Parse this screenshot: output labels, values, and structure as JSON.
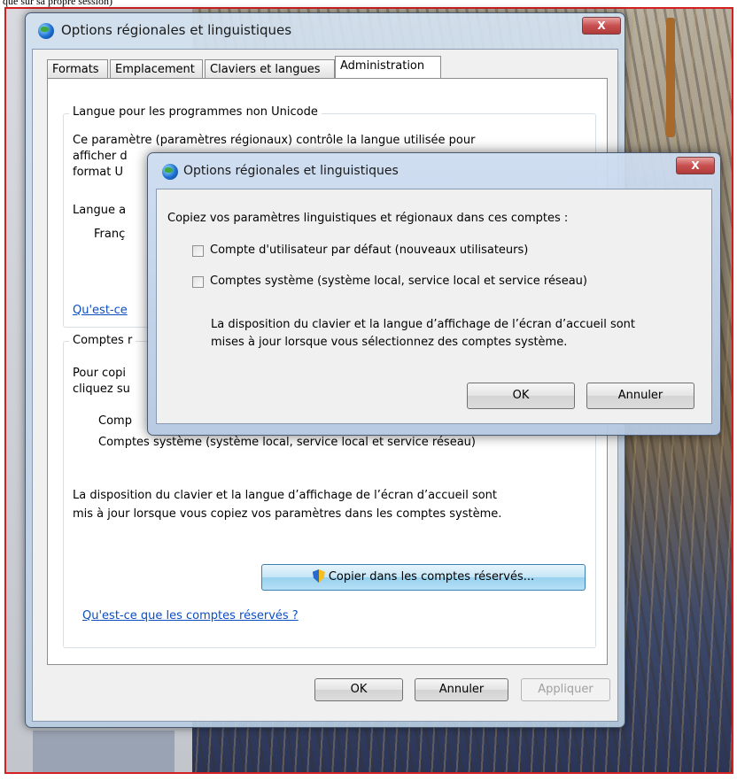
{
  "page": {
    "caption": "que sur sa propre session)"
  },
  "main_dialog": {
    "title": "Options régionales et linguistiques",
    "close_label": "X",
    "tabs": [
      {
        "label": "Formats"
      },
      {
        "label": "Emplacement"
      },
      {
        "label": "Claviers et langues"
      },
      {
        "label": "Administration"
      }
    ],
    "active_tab": "Administration",
    "unicode_group": {
      "title": "Langue pour les programmes non Unicode",
      "desc_line1": "Ce paramètre (paramètres régionaux) contrôle la langue utilisée pour",
      "desc_line2": "afficher d",
      "desc_line3": "format U",
      "current_label": "Langue a",
      "current_value": "Franç",
      "help_link": "Qu'est-ce"
    },
    "reserved_group": {
      "title": "Comptes r",
      "desc_line1": "Pour copi",
      "desc_line2": "cliquez su",
      "item1": "Comp",
      "item2": "Comptes système (système local, service local et service réseau)",
      "note_line1": "La disposition du clavier et la langue d’affichage de l’écran d’accueil sont",
      "note_line2": "mis à jour lorsque vous copiez vos paramètres dans les comptes système.",
      "copy_button": "Copier dans les comptes réservés...",
      "help_link": "Qu'est-ce que les comptes réservés ?"
    },
    "buttons": {
      "ok": "OK",
      "cancel": "Annuler",
      "apply": "Appliquer"
    }
  },
  "copy_dialog": {
    "title": "Options régionales et linguistiques",
    "close_label": "X",
    "instruction": "Copiez vos paramètres linguistiques et régionaux dans ces comptes :",
    "checkboxes": [
      {
        "label": "Compte d'utilisateur par défaut (nouveaux utilisateurs)",
        "checked": false
      },
      {
        "label": "Comptes système (système local, service local et service réseau)",
        "checked": false
      }
    ],
    "note_line1": "La disposition du clavier et la langue d’affichage de l’écran d’accueil sont",
    "note_line2": "mises à jour lorsque vous sélectionnez des comptes système.",
    "buttons": {
      "ok": "OK",
      "cancel": "Annuler"
    }
  }
}
